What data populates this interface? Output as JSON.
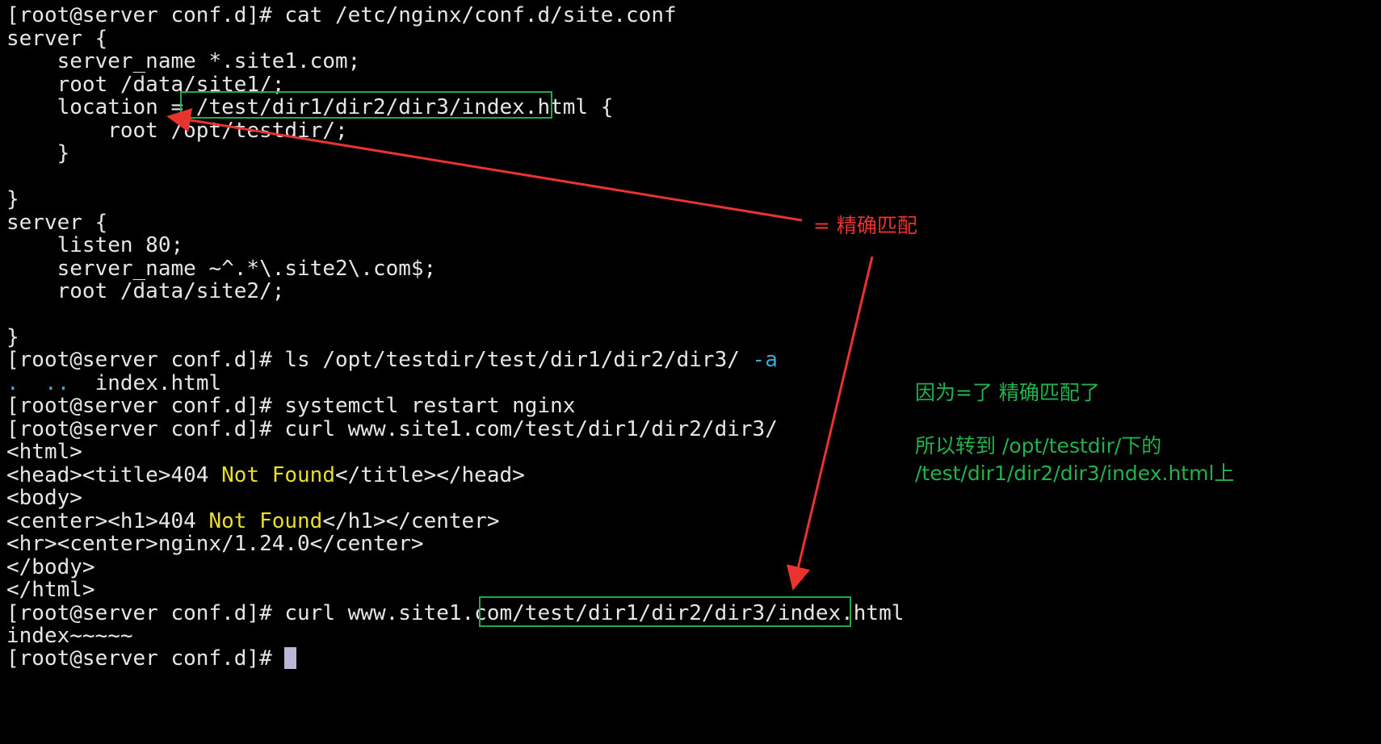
{
  "terminal": {
    "lines": [
      [
        "[root@server conf.d]# cat /etc/nginx/conf.d/site.conf"
      ],
      [
        "server {"
      ],
      [
        "    server_name *.site1.com;"
      ],
      [
        "    root /data/site1/;"
      ],
      [
        "    location = /test/dir1/dir2/dir3/index.html {"
      ],
      [
        "        root /opt/testdir/;"
      ],
      [
        "    }"
      ],
      [
        ""
      ],
      [
        "}"
      ],
      [
        "server {"
      ],
      [
        "    listen 80;"
      ],
      [
        "    server_name ~^.*\\.site2\\.com$;"
      ],
      [
        "    root /data/site2/;"
      ],
      [
        ""
      ],
      [
        "}"
      ],
      [
        "[root@server conf.d]# ls /opt/testdir/test/dir1/dir2/dir3/ ",
        "-a"
      ],
      [
        "",
        ".  ..",
        "  index.html"
      ],
      [
        "[root@server conf.d]# systemctl restart nginx"
      ],
      [
        "[root@server conf.d]# curl www.site1.com/test/dir1/dir2/dir3/"
      ],
      [
        "<html>"
      ],
      [
        "<head><title>404 ",
        "Not Found",
        "</title></head>"
      ],
      [
        "<body>"
      ],
      [
        "<center><h1>404 ",
        "Not Found",
        "</h1></center>"
      ],
      [
        "<hr><center>nginx/1.24.0</center>"
      ],
      [
        "</body>"
      ],
      [
        "</html>"
      ],
      [
        "[root@server conf.d]# curl www.site1.com/test/dir1/dir2/dir3/index.html"
      ],
      [
        "index~~~~~"
      ],
      [
        "[root@server conf.d]# "
      ]
    ]
  },
  "annotations": {
    "exact_match_label": "= 精确匹配",
    "reason_line1": "因为=了 精确匹配了",
    "reason_line2": "所以转到 /opt/testdir/下的",
    "reason_line3": "/test/dir1/dir2/dir3/index.html上"
  },
  "colors": {
    "background": "#000000",
    "text": "#e6e6e6",
    "highlight_yellow": "#e8df2a",
    "highlight_cyan": "#3aa7d8",
    "box_green": "#23a84a",
    "annotation_red": "#e8332f",
    "annotation_green": "#22b24c",
    "cursor": "#bdb6d6"
  }
}
